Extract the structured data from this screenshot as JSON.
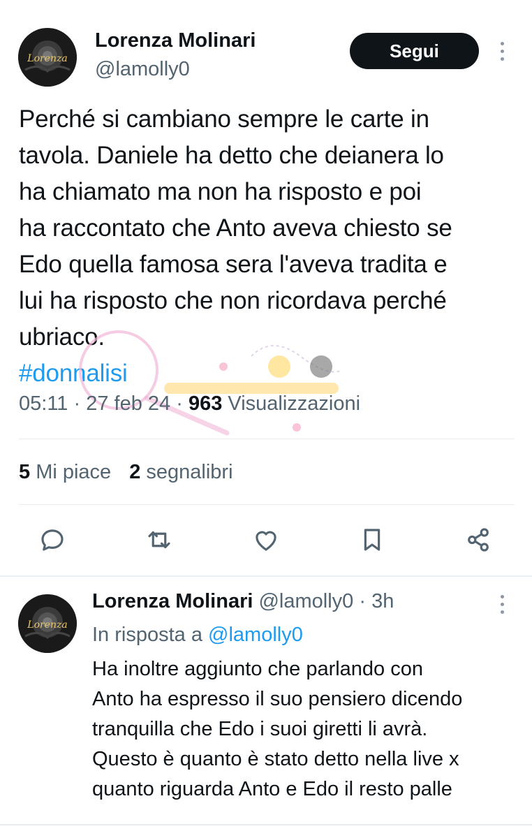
{
  "main_tweet": {
    "author_name": "Lorenza Molinari",
    "author_handle": "@lamolly0",
    "avatar_text": "Lorenza",
    "follow_label": "Segui",
    "text_lines": [
      "Perché si cambiano sempre le carte in",
      "tavola. Daniele ha detto che deianera lo",
      "ha chiamato ma non ha risposto e poi",
      "ha raccontato che Anto aveva chiesto se",
      "Edo quella famosa sera l'aveva tradita e",
      "lui ha risposto che non ricordava perché",
      "ubriaco."
    ],
    "hashtag": "#donnalisi",
    "time": "05:11",
    "date": "27 feb 24",
    "views_count": "963",
    "views_label": "Visualizzazioni",
    "likes_count": "5",
    "likes_label": "Mi piace",
    "bookmarks_count": "2",
    "bookmarks_label": "segnalibri"
  },
  "actions": [
    "reply-icon",
    "retweet-icon",
    "like-icon",
    "bookmark-icon",
    "share-icon"
  ],
  "reply_tweet": {
    "author_name": "Lorenza Molinari",
    "author_handle": "@lamolly0",
    "age": "· 3h",
    "in_reply_label": "In risposta a",
    "in_reply_mention": "@lamolly0",
    "text_lines": [
      "Ha inoltre aggiunto che parlando con",
      "Anto ha espresso il suo pensiero dicendo",
      "tranquilla che Edo i suoi giretti li avrà.",
      "Questo è quanto è stato detto nella live x",
      "quanto riguarda Anto e Edo il resto palle"
    ]
  },
  "colors": {
    "text": "#0f1419",
    "secondary": "#536471",
    "accent": "#1d9bf0",
    "button_bg": "#0f1419"
  }
}
